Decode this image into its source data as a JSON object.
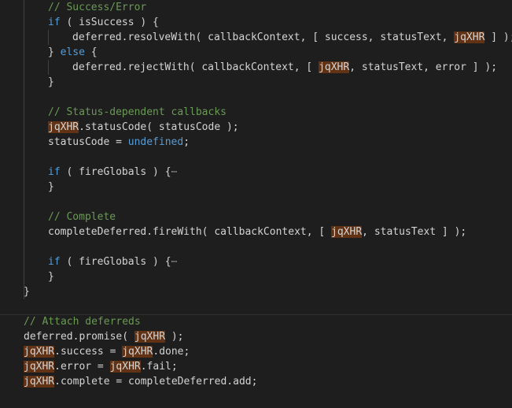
{
  "colors": {
    "background": "#1e1e1e",
    "text": "#d4d4d4",
    "keyword": "#569cd6",
    "comment": "#6a9955",
    "highlight": "#613214",
    "indent_guide": "#404040"
  },
  "lines": [
    {
      "indent": 2,
      "tokens": [
        {
          "t": "// Success/Error",
          "c": "cm"
        }
      ]
    },
    {
      "indent": 2,
      "tokens": [
        {
          "t": "if",
          "c": "kw"
        },
        {
          "t": " ( isSuccess ) {"
        }
      ]
    },
    {
      "indent": 3,
      "tokens": [
        {
          "t": "deferred.resolveWith( callbackContext, [ success, statusText, "
        },
        {
          "t": "jqXHR",
          "c": "hl"
        },
        {
          "t": " ] );"
        }
      ]
    },
    {
      "indent": 2,
      "tokens": [
        {
          "t": "} "
        },
        {
          "t": "else",
          "c": "kw"
        },
        {
          "t": " {"
        }
      ]
    },
    {
      "indent": 3,
      "tokens": [
        {
          "t": "deferred.rejectWith( callbackContext, [ "
        },
        {
          "t": "jqXHR",
          "c": "hl"
        },
        {
          "t": ", statusText, error ] );"
        }
      ]
    },
    {
      "indent": 2,
      "tokens": [
        {
          "t": "}"
        }
      ]
    },
    {
      "indent": 0,
      "tokens": []
    },
    {
      "indent": 2,
      "tokens": [
        {
          "t": "// Status-dependent callbacks",
          "c": "cm"
        }
      ]
    },
    {
      "indent": 2,
      "tokens": [
        {
          "t": "jqXHR",
          "c": "hl"
        },
        {
          "t": ".statusCode( statusCode );"
        }
      ]
    },
    {
      "indent": 2,
      "tokens": [
        {
          "t": "statusCode = "
        },
        {
          "t": "undefined",
          "c": "kw"
        },
        {
          "t": ";"
        }
      ]
    },
    {
      "indent": 0,
      "tokens": []
    },
    {
      "indent": 2,
      "tokens": [
        {
          "t": "if",
          "c": "kw"
        },
        {
          "t": " ( fireGlobals ) {"
        },
        {
          "t": "⋯",
          "c": "ellipsis"
        }
      ]
    },
    {
      "indent": 2,
      "tokens": [
        {
          "t": "}"
        }
      ]
    },
    {
      "indent": 0,
      "tokens": []
    },
    {
      "indent": 2,
      "tokens": [
        {
          "t": "// Complete",
          "c": "cm"
        }
      ]
    },
    {
      "indent": 2,
      "tokens": [
        {
          "t": "completeDeferred.fireWith( callbackContext, [ "
        },
        {
          "t": "jqXHR",
          "c": "hl"
        },
        {
          "t": ", statusText ] );"
        }
      ]
    },
    {
      "indent": 0,
      "tokens": []
    },
    {
      "indent": 2,
      "tokens": [
        {
          "t": "if",
          "c": "kw"
        },
        {
          "t": " ( fireGlobals ) {"
        },
        {
          "t": "⋯",
          "c": "ellipsis"
        }
      ]
    },
    {
      "indent": 2,
      "tokens": [
        {
          "t": "}"
        }
      ]
    },
    {
      "indent": 1,
      "tokens": [
        {
          "t": "}"
        }
      ]
    },
    {
      "indent": 0,
      "tokens": []
    },
    {
      "indent": 1,
      "tokens": [
        {
          "t": "// Attach deferreds",
          "c": "cm"
        }
      ]
    },
    {
      "indent": 1,
      "tokens": [
        {
          "t": "deferred.promise( "
        },
        {
          "t": "jqXHR",
          "c": "hl"
        },
        {
          "t": " );"
        }
      ]
    },
    {
      "indent": 1,
      "tokens": [
        {
          "t": "jqXHR",
          "c": "hl"
        },
        {
          "t": ".success = "
        },
        {
          "t": "jqXHR",
          "c": "hl"
        },
        {
          "t": ".done;"
        }
      ]
    },
    {
      "indent": 1,
      "tokens": [
        {
          "t": "jqXHR",
          "c": "hl"
        },
        {
          "t": ".error = "
        },
        {
          "t": "jqXHR",
          "c": "hl"
        },
        {
          "t": ".fail;"
        }
      ]
    },
    {
      "indent": 1,
      "tokens": [
        {
          "t": "jqXHR",
          "c": "hl"
        },
        {
          "t": ".complete = completeDeferred.add;"
        }
      ]
    }
  ]
}
